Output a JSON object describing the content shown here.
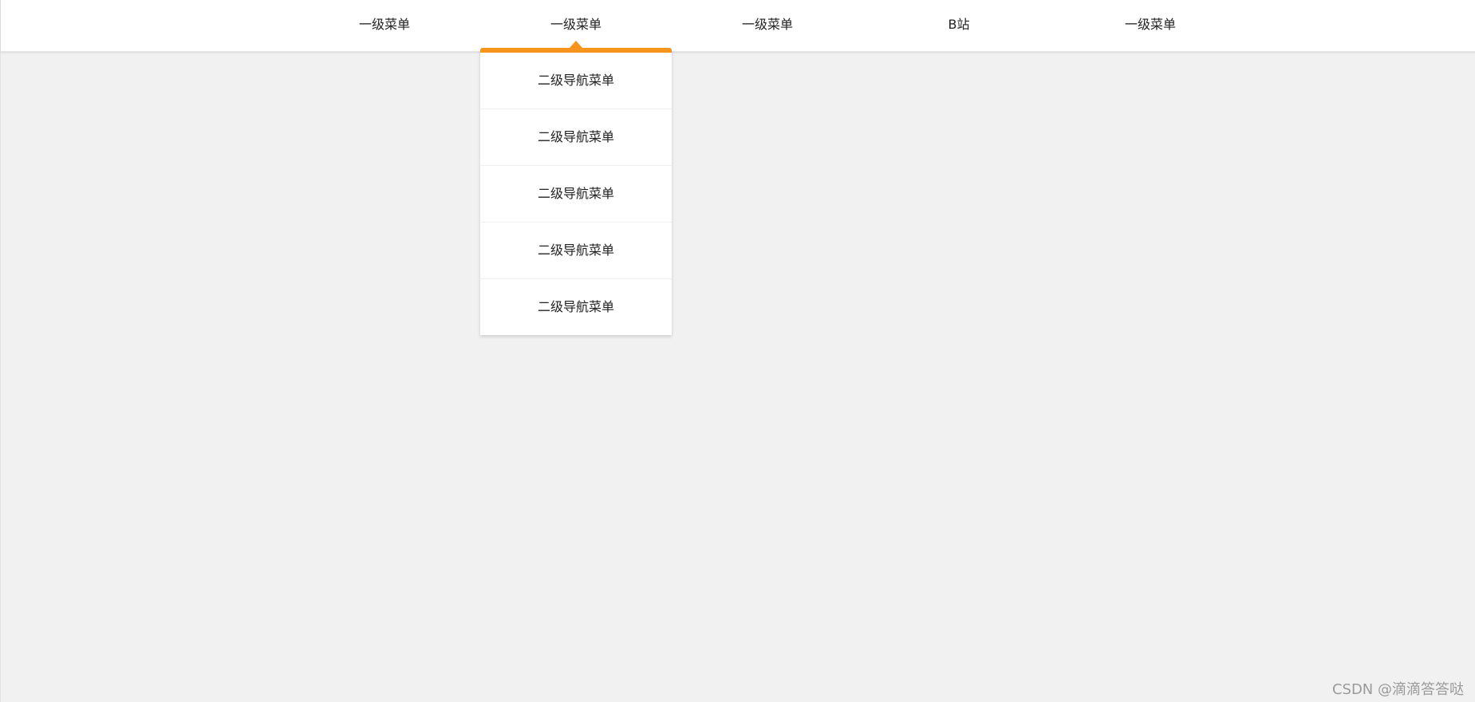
{
  "nav": {
    "items": [
      {
        "label": "一级菜单"
      },
      {
        "label": "一级菜单"
      },
      {
        "label": "一级菜单"
      },
      {
        "label": "B站"
      },
      {
        "label": "一级菜单"
      }
    ]
  },
  "dropdown": {
    "items": [
      {
        "label": "二级导航菜单"
      },
      {
        "label": "二级导航菜单"
      },
      {
        "label": "二级导航菜单"
      },
      {
        "label": "二级导航菜单"
      },
      {
        "label": "二级导航菜单"
      }
    ]
  },
  "watermark": "CSDN @滴滴答答哒",
  "colors": {
    "accent": "#f7941d",
    "background": "#f1f1f1",
    "bar": "#ffffff"
  }
}
